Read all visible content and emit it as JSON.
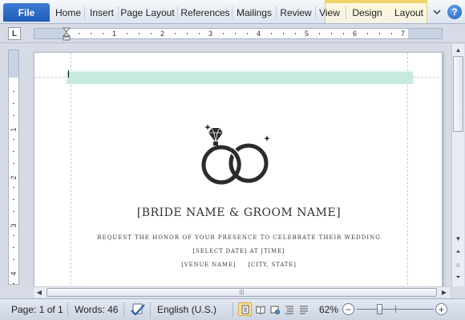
{
  "ribbon": {
    "file_tab": "File",
    "tabs": [
      "Home",
      "Insert",
      "Page Layout",
      "References",
      "Mailings",
      "Review",
      "View"
    ],
    "contextual_tabs": [
      "Design",
      "Layout"
    ],
    "help_label": "?"
  },
  "ruler": {
    "tab_selector": "L",
    "h_numbers": [
      "1",
      "2",
      "3",
      "4",
      "5",
      "6",
      "7"
    ],
    "v_numbers": [
      "1",
      "2",
      "3",
      "4"
    ]
  },
  "document": {
    "names": "[BRIDE NAME & GROOM NAME]",
    "request": "REQUEST THE HONOR OF YOUR PRESENCE TO CELEBRATE THEIR WEDDING",
    "date_time": "[SELECT DATE] AT [TIME]",
    "venue": "[VENUE NAME]",
    "city_state": "[CITY, STATE]"
  },
  "status_bar": {
    "page": "Page: 1 of 1",
    "words": "Words: 46",
    "language": "English (U.S.)",
    "zoom": "62%",
    "zoom_level": 0.62,
    "active_view": "print-layout"
  },
  "colors": {
    "file_tab": "#2a6ac8",
    "header_band": "#c7eadc",
    "contextual_tab": "#f2d36b",
    "active_view": "#fbe29a"
  }
}
